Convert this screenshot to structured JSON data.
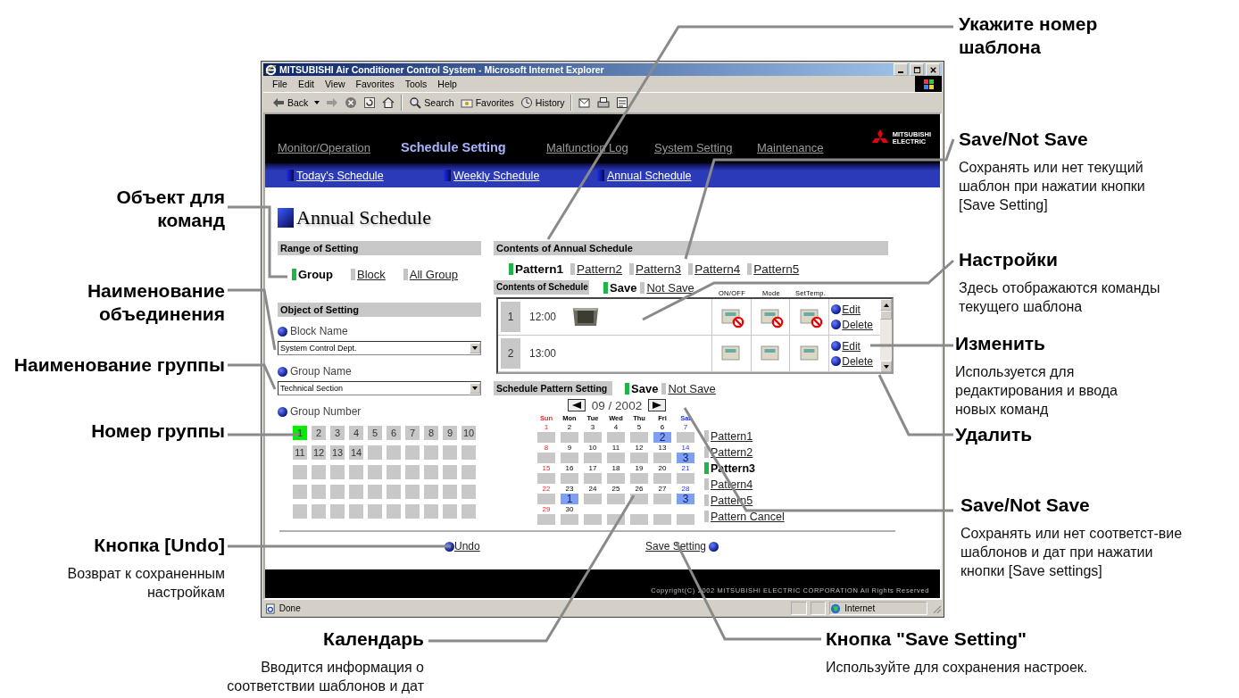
{
  "browser": {
    "title": "MITSUBISHI Air Conditioner Control System - Microsoft Internet Explorer",
    "menu": [
      "File",
      "Edit",
      "View",
      "Favorites",
      "Tools",
      "Help"
    ],
    "toolbar": [
      "Back",
      "Search",
      "Favorites",
      "History"
    ],
    "status": "Done",
    "zone": "Internet"
  },
  "header": {
    "nav": [
      {
        "label": "Monitor/Operation",
        "selected": false
      },
      {
        "label": "Schedule Setting",
        "selected": true
      },
      {
        "label": "Malfunction Log",
        "selected": false
      },
      {
        "label": "System Setting",
        "selected": false
      },
      {
        "label": "Maintenance",
        "selected": false
      }
    ],
    "logo": [
      "MITSUBISHI",
      "ELECTRIC"
    ],
    "subnav": [
      "Today's Schedule",
      "Weekly Schedule",
      "Annual Schedule"
    ]
  },
  "page_title": "Annual Schedule",
  "range": {
    "heading": "Range of Setting",
    "options": [
      {
        "label": "Group",
        "selected": true
      },
      {
        "label": "Block",
        "selected": false
      },
      {
        "label": "All Group",
        "selected": false
      }
    ]
  },
  "object": {
    "heading": "Object of Setting",
    "block_label": "Block Name",
    "block_value": "System Control Dept.",
    "group_label": "Group Name",
    "group_value": "Technical Section",
    "number_label": "Group Number",
    "numbers": [
      {
        "label": "1",
        "selected": true
      },
      {
        "label": "2",
        "selected": false
      },
      {
        "label": "3",
        "selected": false
      },
      {
        "label": "4",
        "selected": false
      },
      {
        "label": "5",
        "selected": false
      },
      {
        "label": "6",
        "selected": false
      },
      {
        "label": "7",
        "selected": false
      },
      {
        "label": "8",
        "selected": false
      },
      {
        "label": "9",
        "selected": false
      },
      {
        "label": "10",
        "selected": false
      },
      {
        "label": "11",
        "selected": false
      },
      {
        "label": "12",
        "selected": false
      },
      {
        "label": "13",
        "selected": false
      },
      {
        "label": "14",
        "selected": false
      }
    ]
  },
  "contents": {
    "heading": "Contents of Annual Schedule",
    "patterns": [
      {
        "label": "Pattern1",
        "selected": true
      },
      {
        "label": "Pattern2",
        "selected": false
      },
      {
        "label": "Pattern3",
        "selected": false
      },
      {
        "label": "Pattern4",
        "selected": false
      },
      {
        "label": "Pattern5",
        "selected": false
      }
    ],
    "schedule_label": "Contents of Schedule",
    "save_options": [
      {
        "label": "Save",
        "selected": true
      },
      {
        "label": "Not Save",
        "selected": false
      }
    ],
    "columns": [
      "ON/OFF",
      "Mode",
      "SetTemp."
    ],
    "rows": [
      {
        "index": "1",
        "time": "12:00",
        "unit_icon": true,
        "prohibited": [
          true,
          true,
          true
        ],
        "actions": [
          "Edit",
          "Delete"
        ]
      },
      {
        "index": "2",
        "time": "13:00",
        "unit_icon": false,
        "prohibited": [
          false,
          false,
          false
        ],
        "actions": [
          "Edit",
          "Delete"
        ]
      }
    ]
  },
  "pattern_setting": {
    "heading": "Schedule Pattern Setting",
    "save_options": [
      {
        "label": "Save",
        "selected": true
      },
      {
        "label": "Not Save",
        "selected": false
      }
    ],
    "month": "09 / 2002",
    "weekdays": [
      {
        "label": "Sun",
        "kind": "sunday"
      },
      {
        "label": "Mon",
        "kind": "weekday"
      },
      {
        "label": "Tue",
        "kind": "weekday"
      },
      {
        "label": "Wed",
        "kind": "weekday"
      },
      {
        "label": "Thu",
        "kind": "weekday"
      },
      {
        "label": "Fri",
        "kind": "weekday"
      },
      {
        "label": "Sat",
        "kind": "saturday"
      }
    ],
    "weeks": [
      [
        {
          "day": "1"
        },
        {
          "day": "2"
        },
        {
          "day": "3"
        },
        {
          "day": "4"
        },
        {
          "day": "5"
        },
        {
          "day": "6",
          "pattern": "2"
        },
        {
          "day": "7"
        }
      ],
      [
        {
          "day": "8"
        },
        {
          "day": "9"
        },
        {
          "day": "10"
        },
        {
          "day": "11"
        },
        {
          "day": "12"
        },
        {
          "day": "13"
        },
        {
          "day": "14",
          "pattern": "3"
        }
      ],
      [
        {
          "day": "15"
        },
        {
          "day": "16"
        },
        {
          "day": "17"
        },
        {
          "day": "18"
        },
        {
          "day": "19"
        },
        {
          "day": "20"
        },
        {
          "day": "21"
        }
      ],
      [
        {
          "day": "22"
        },
        {
          "day": "23",
          "pattern": "1"
        },
        {
          "day": "24"
        },
        {
          "day": "25"
        },
        {
          "day": "26"
        },
        {
          "day": "27"
        },
        {
          "day": "28",
          "pattern": "3"
        }
      ],
      [
        {
          "day": "29"
        },
        {
          "day": "30"
        }
      ]
    ],
    "patterns": [
      {
        "label": "Pattern1",
        "selected": false
      },
      {
        "label": "Pattern2",
        "selected": false
      },
      {
        "label": "Pattern3",
        "selected": true
      },
      {
        "label": "Pattern4",
        "selected": false
      },
      {
        "label": "Pattern5",
        "selected": false
      },
      {
        "label": "Pattern Cancel",
        "selected": false
      }
    ]
  },
  "undo": "Undo",
  "save_setting": "Save Setting",
  "copyright": "Copyright(C) 2002 MITSUBISHI ELECTRIC CORPORATION All Rights Reserved",
  "callouts": [
    {
      "title": "Укажите номер шаблона"
    },
    {
      "title": "Save/Not Save",
      "text": "Сохранять или нет текущий шаблон при нажатии кнопки [Save Setting]"
    },
    {
      "title": "Объект для команд"
    },
    {
      "title": "Настройки",
      "text": "Здесь отображаются команды текущего шаблона"
    },
    {
      "title": "Наименование объединения"
    },
    {
      "title": "Изменить",
      "text": "Используется для редактирования и ввода новых команд"
    },
    {
      "title": "Наименование группы"
    },
    {
      "title": "Удалить"
    },
    {
      "title": "Номер группы"
    },
    {
      "title": "Save/Not Save",
      "text": "Сохранять или нет соответст-вие шаблонов и дат при нажатии кнопки [Save settings]"
    },
    {
      "title": "Кнопка [Undo]",
      "text": "Возврат к сохраненным настройкам"
    },
    {
      "title": "Календарь",
      "text": "Вводится информация о соответствии шаблонов и дат"
    },
    {
      "title": "Кнопка \"Save Setting\"",
      "text": "Используйте для сохранения настроек."
    }
  ]
}
